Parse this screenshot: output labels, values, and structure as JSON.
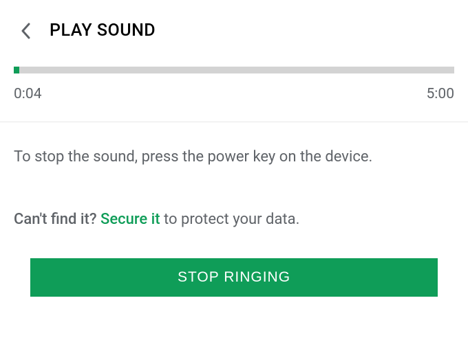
{
  "header": {
    "title": "PLAY SOUND"
  },
  "progress": {
    "elapsed": "0:04",
    "total": "5:00",
    "percent": 1.3
  },
  "instruction": "To stop the sound, press the power key on the device.",
  "cant_find": {
    "prefix": "Can't find it? ",
    "link": "Secure it",
    "suffix": " to protect your data."
  },
  "button": {
    "stop_label": "STOP RINGING"
  },
  "colors": {
    "accent": "#0F9D58"
  }
}
